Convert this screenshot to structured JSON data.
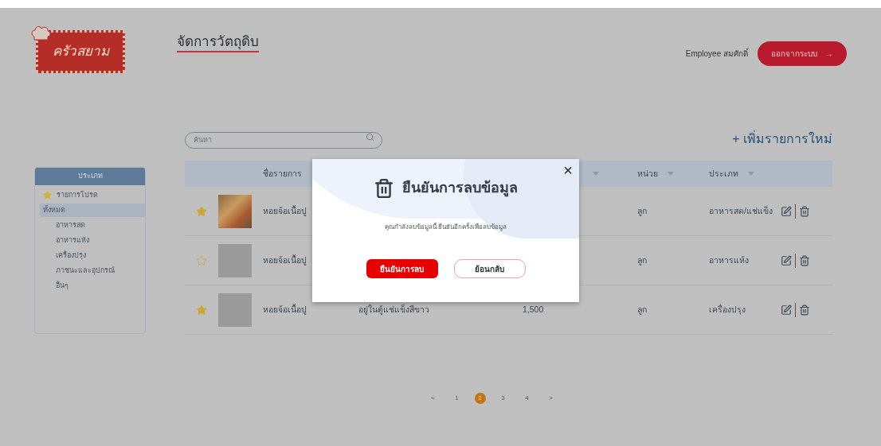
{
  "header": {
    "logo_text": "ครัวสยาม",
    "title": "จัดการวัตถุดิบ",
    "user": "Employee สมศักดิ์",
    "logout_button": "ออกจากระบบ",
    "logout_icon": "→"
  },
  "search": {
    "placeholder": "ค้นหา"
  },
  "add_new": "+ เพิ่มรายการใหม่",
  "sidebar": {
    "title": "ประเภท",
    "items": [
      {
        "label": "รายการโปรด",
        "kind": "favorite",
        "selected": false
      },
      {
        "label": "ทั้งหมด",
        "kind": "group",
        "selected": true,
        "children": [
          {
            "label": "อาหารสด",
            "selected": false
          },
          {
            "label": "อาหารแห้ง",
            "selected": false
          },
          {
            "label": "เครื่องปรุง",
            "selected": false
          },
          {
            "label": "ภาชนะและอุปกรณ์",
            "selected": false
          },
          {
            "label": "อื่นๆ",
            "selected": false
          }
        ]
      }
    ]
  },
  "table": {
    "columns": [
      {
        "label": "ชื่อรายการ",
        "sortable": false
      },
      {
        "sortable": true
      },
      {
        "label": "หน่วย",
        "sortable": true
      },
      {
        "label": "ประเภท",
        "sortable": true
      }
    ],
    "rows": [
      {
        "favorite": true,
        "photo": true,
        "name": "หอยจ้อเนื้อปู",
        "unit": "ลูก",
        "type": "อาหารสด/แช่แข็ง"
      },
      {
        "favorite": false,
        "photo": false,
        "name": "หอยจ้อเนื้อปู",
        "unit": "ลูก",
        "type": "อาหารแห้ง"
      },
      {
        "favorite": true,
        "photo": false,
        "name": "หอยจ้อเนื้อปู",
        "location": "อยู่ในตู้แช่แข็งสีขาว",
        "quantity": "1,500",
        "unit": "ลูก",
        "type": "เครื่องปรุง"
      }
    ]
  },
  "pagination": {
    "prev": "<",
    "next": ">",
    "pages": [
      {
        "label": "1",
        "selected": false
      },
      {
        "label": "2",
        "selected": true
      },
      {
        "label": "3",
        "selected": false
      },
      {
        "label": "4",
        "selected": false
      }
    ]
  },
  "modal": {
    "title": "ยืนยันการลบข้อมูล",
    "message": "คุณกำลังลบข้อมูลนี้ ยืนยันอีกครั้งเพื่อลบข้อมูล",
    "close": "×",
    "buttons": [
      {
        "label": "ยืนยันการลบ",
        "kind": "primary"
      },
      {
        "label": "ย้อนกลับ",
        "kind": "secondary"
      }
    ]
  }
}
